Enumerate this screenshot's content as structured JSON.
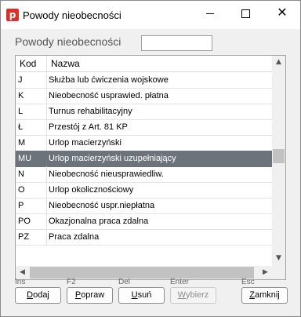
{
  "window": {
    "title": "Powody nieobecności",
    "app_icon_letter": "p",
    "minimize_glyph": "—",
    "maximize_glyph": "☐",
    "close_glyph": "✕"
  },
  "heading": "Powody nieobecności",
  "search": {
    "value": ""
  },
  "table": {
    "columns": [
      "Kod",
      "Nazwa"
    ],
    "rows": [
      {
        "kod": "J",
        "nazwa": "Służba lub ćwiczenia wojskowe"
      },
      {
        "kod": "K",
        "nazwa": "Nieobecność usprawied. płatna"
      },
      {
        "kod": "L",
        "nazwa": "Turnus rehabilitacyjny"
      },
      {
        "kod": "Ł",
        "nazwa": "Przestój z Art. 81 KP"
      },
      {
        "kod": "M",
        "nazwa": "Urlop macierzyński"
      },
      {
        "kod": "MU",
        "nazwa": "Urlop macierzyński uzupełniający"
      },
      {
        "kod": "N",
        "nazwa": "Nieobecność nieusprawiedliw."
      },
      {
        "kod": "O",
        "nazwa": "Urlop okolicznościowy"
      },
      {
        "kod": "P",
        "nazwa": "Nieobecność uspr.niepłatna"
      },
      {
        "kod": "PO",
        "nazwa": "Okazjonalna praca zdalna"
      },
      {
        "kod": "PZ",
        "nazwa": "Praca zdalna"
      }
    ],
    "selected_row": 5
  },
  "scroll": {
    "up": "▲",
    "down": "▼",
    "left": "◀",
    "right": "▶"
  },
  "buttons": [
    {
      "hint": "Ins",
      "label": "Dodaj",
      "enabled": true
    },
    {
      "hint": "F2",
      "label": "Popraw",
      "enabled": true
    },
    {
      "hint": "Del",
      "label": "Usuń",
      "enabled": true
    },
    {
      "hint": "Enter",
      "label": "Wybierz",
      "enabled": false
    },
    {
      "hint": "Esc",
      "label": "Zamknij",
      "enabled": true
    }
  ],
  "colors": {
    "selected_row": "#6d737b",
    "app_icon": "#d9302c"
  }
}
